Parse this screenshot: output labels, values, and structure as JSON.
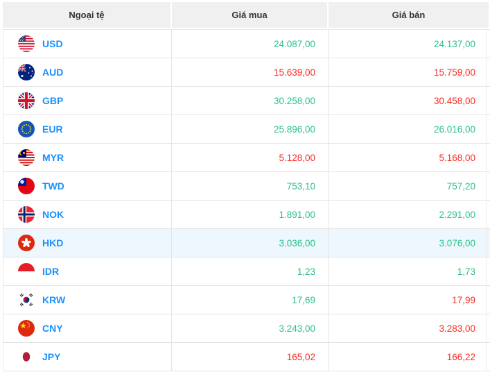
{
  "header": {
    "columns": [
      "Ngoại tệ",
      "Giá mua",
      "Giá bán"
    ]
  },
  "rows": [
    {
      "code": "USD",
      "flag_icon": "usd-flag-icon",
      "buy": "24.087,00",
      "buy_trend": "up",
      "sell": "24.137,00",
      "sell_trend": "up",
      "highlighted": false
    },
    {
      "code": "AUD",
      "flag_icon": "aud-flag-icon",
      "buy": "15.639,00",
      "buy_trend": "down",
      "sell": "15.759,00",
      "sell_trend": "down",
      "highlighted": false
    },
    {
      "code": "GBP",
      "flag_icon": "gbp-flag-icon",
      "buy": "30.258,00",
      "buy_trend": "up",
      "sell": "30.458,00",
      "sell_trend": "down",
      "highlighted": false
    },
    {
      "code": "EUR",
      "flag_icon": "eur-flag-icon",
      "buy": "25.896,00",
      "buy_trend": "up",
      "sell": "26.016,00",
      "sell_trend": "up",
      "highlighted": false
    },
    {
      "code": "MYR",
      "flag_icon": "myr-flag-icon",
      "buy": "5.128,00",
      "buy_trend": "down",
      "sell": "5.168,00",
      "sell_trend": "down",
      "highlighted": false
    },
    {
      "code": "TWD",
      "flag_icon": "twd-flag-icon",
      "buy": "753,10",
      "buy_trend": "up",
      "sell": "757,20",
      "sell_trend": "up",
      "highlighted": false
    },
    {
      "code": "NOK",
      "flag_icon": "nok-flag-icon",
      "buy": "1.891,00",
      "buy_trend": "up",
      "sell": "2.291,00",
      "sell_trend": "up",
      "highlighted": false
    },
    {
      "code": "HKD",
      "flag_icon": "hkd-flag-icon",
      "buy": "3.036,00",
      "buy_trend": "up",
      "sell": "3.076,00",
      "sell_trend": "up",
      "highlighted": true
    },
    {
      "code": "IDR",
      "flag_icon": "idr-flag-icon",
      "buy": "1,23",
      "buy_trend": "up",
      "sell": "1,73",
      "sell_trend": "up",
      "highlighted": false
    },
    {
      "code": "KRW",
      "flag_icon": "krw-flag-icon",
      "buy": "17,69",
      "buy_trend": "up",
      "sell": "17,99",
      "sell_trend": "down",
      "highlighted": false
    },
    {
      "code": "CNY",
      "flag_icon": "cny-flag-icon",
      "buy": "3.243,00",
      "buy_trend": "up",
      "sell": "3.283,00",
      "sell_trend": "down",
      "highlighted": false
    },
    {
      "code": "JPY",
      "flag_icon": "jpy-flag-icon",
      "buy": "165,02",
      "buy_trend": "down",
      "sell": "166,22",
      "sell_trend": "down",
      "highlighted": false
    }
  ],
  "colors": {
    "accent_blue": "#1890ff",
    "price_up_green": "#2ac189",
    "price_down_red": "#fa2c23",
    "header_bg": "#f0f0f0",
    "highlight_row_bg": "#eef7fe"
  }
}
